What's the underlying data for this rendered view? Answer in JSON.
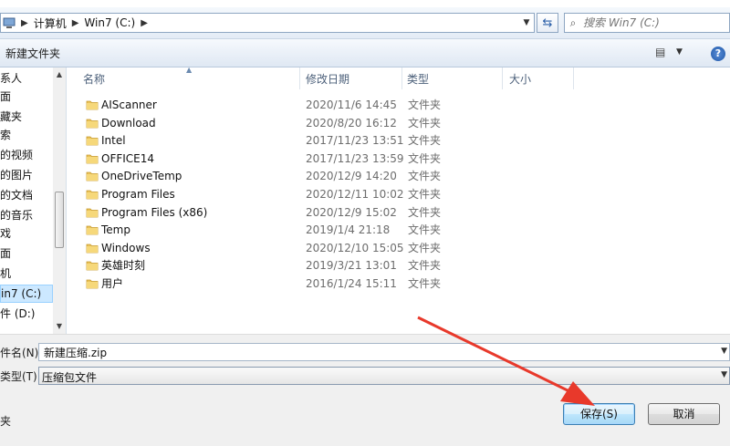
{
  "address": {
    "crumbs": [
      "计算机",
      "Win7 (C:)"
    ],
    "search_placeholder": "搜索 Win7 (C:)"
  },
  "toolbar": {
    "new_folder_label": "新建文件夹"
  },
  "nav": {
    "items": [
      "系人",
      "",
      "藏夹",
      "",
      "的视频",
      "的图片",
      "的文档",
      "的音乐",
      "戏",
      "面",
      "机",
      "in7 (C:)",
      "件 (D:)"
    ]
  },
  "columns": [
    "名称",
    "修改日期",
    "类型",
    "大小"
  ],
  "files": [
    {
      "name": "AIScanner",
      "date": "2020/11/6 14:45",
      "type": "文件夹"
    },
    {
      "name": "Download",
      "date": "2020/8/20 16:12",
      "type": "文件夹"
    },
    {
      "name": "Intel",
      "date": "2017/11/23 13:51",
      "type": "文件夹"
    },
    {
      "name": "OFFICE14",
      "date": "2017/11/23 13:59",
      "type": "文件夹"
    },
    {
      "name": "OneDriveTemp",
      "date": "2020/12/9 14:20",
      "type": "文件夹"
    },
    {
      "name": "Program Files",
      "date": "2020/12/11 10:02",
      "type": "文件夹"
    },
    {
      "name": "Program Files (x86)",
      "date": "2020/12/9 15:02",
      "type": "文件夹"
    },
    {
      "name": "Temp",
      "date": "2019/1/4 21:18",
      "type": "文件夹"
    },
    {
      "name": "Windows",
      "date": "2020/12/10 15:05",
      "type": "文件夹"
    },
    {
      "name": "英雄时刻",
      "date": "2019/3/21 13:01",
      "type": "文件夹"
    },
    {
      "name": "用户",
      "date": "2016/1/24 15:11",
      "type": "文件夹"
    }
  ],
  "form": {
    "filename_label": "件名(N):",
    "filename_value": "新建压缩.zip",
    "filetype_label": "类型(T):",
    "filetype_value": "压缩包文件",
    "hide_folders_label": "夹"
  },
  "buttons": {
    "save": "保存(S)",
    "cancel": "取消"
  },
  "colors": {
    "selection": "#cce8ff",
    "annotation_arrow": "#e8392b"
  }
}
